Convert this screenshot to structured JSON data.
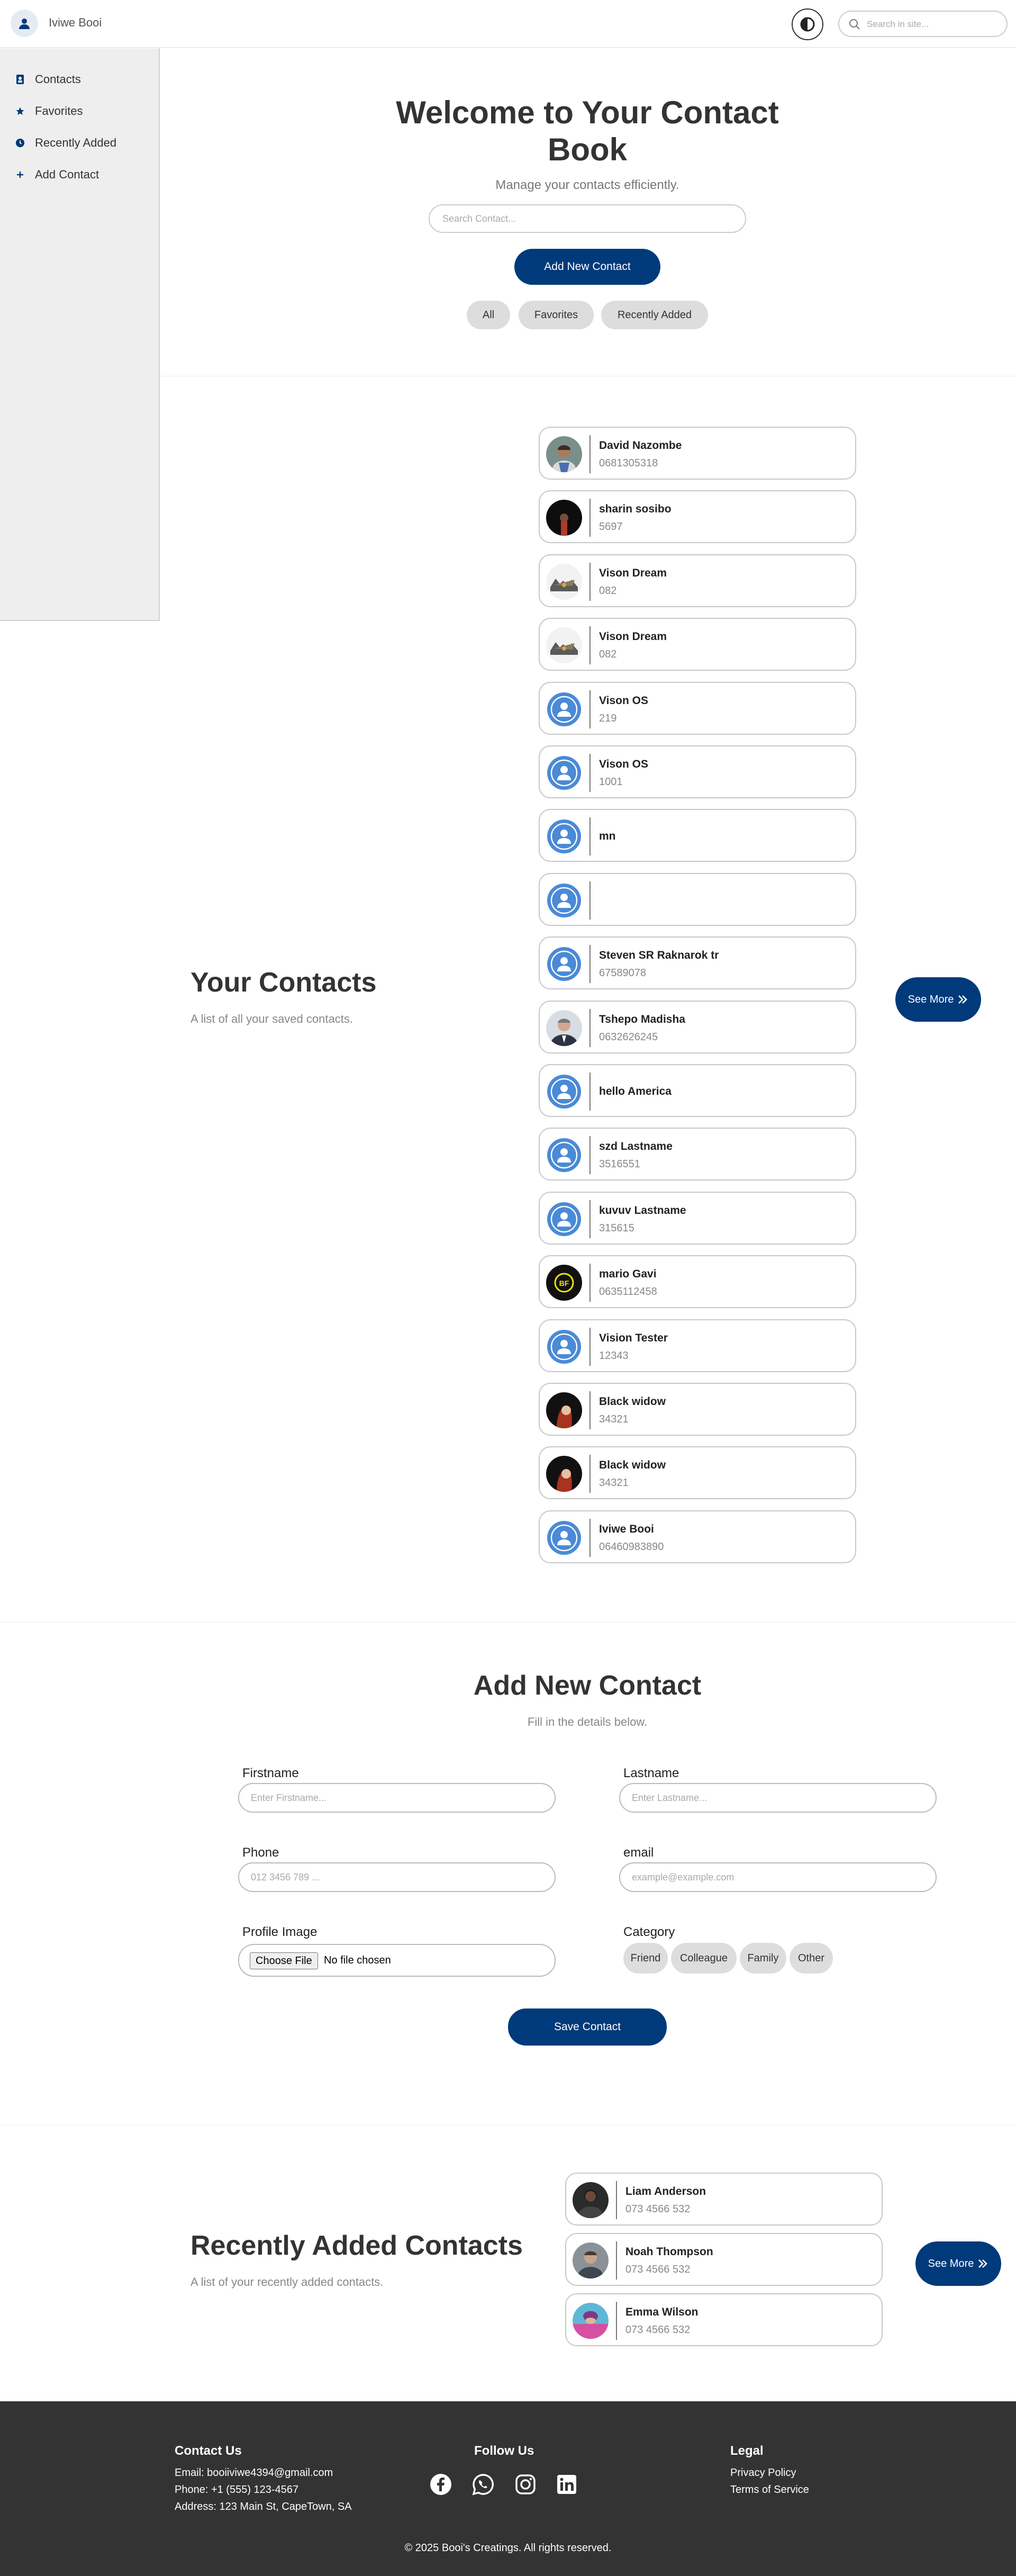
{
  "header": {
    "brand": "Iviwe Booi",
    "search_placeholder": "Search in site..."
  },
  "sidebar": {
    "items": [
      {
        "label": "Contacts",
        "icon": "address-book-icon"
      },
      {
        "label": "Favorites",
        "icon": "star-icon"
      },
      {
        "label": "Recently Added",
        "icon": "clock-icon"
      },
      {
        "label": "Add Contact",
        "icon": "plus-icon"
      }
    ]
  },
  "hero": {
    "title_line1": "Welcome to Your Contact",
    "title_line2": "Book",
    "subtitle": "Manage your contacts efficiently.",
    "search_placeholder": "Search Contact...",
    "add_button": "Add New Contact",
    "filters": [
      "All",
      "Favorites",
      "Recently Added"
    ]
  },
  "contacts_section": {
    "title": "Your Contacts",
    "subtitle": "A list of all your saved contacts.",
    "see_more": "See More",
    "contacts": [
      {
        "name": "David Nazombe",
        "phone": "0681305318",
        "avatar": "photo"
      },
      {
        "name": "sharin sosibo",
        "phone": "5697",
        "avatar": "photo"
      },
      {
        "name": "Vison Dream",
        "phone": "082",
        "avatar": "photo"
      },
      {
        "name": "Vison Dream",
        "phone": "082",
        "avatar": "photo"
      },
      {
        "name": "Vison OS",
        "phone": "219",
        "avatar": "default"
      },
      {
        "name": "Vison OS",
        "phone": "1001",
        "avatar": "default"
      },
      {
        "name": "mn",
        "phone": "",
        "avatar": "default"
      },
      {
        "name": "",
        "phone": "",
        "avatar": "default"
      },
      {
        "name": "Steven SR Raknarok tr",
        "phone": "67589078",
        "avatar": "default"
      },
      {
        "name": "Tshepo Madisha",
        "phone": "0632626245",
        "avatar": "photo"
      },
      {
        "name": "hello America",
        "phone": "",
        "avatar": "default"
      },
      {
        "name": "szd Lastname",
        "phone": "3516551",
        "avatar": "default"
      },
      {
        "name": "kuvuv Lastname",
        "phone": "315615",
        "avatar": "default"
      },
      {
        "name": "mario Gavi",
        "phone": "0635112458",
        "avatar": "logo"
      },
      {
        "name": "Vision Tester",
        "phone": "12343",
        "avatar": "default"
      },
      {
        "name": "Black widow",
        "phone": "34321",
        "avatar": "photo"
      },
      {
        "name": "Black widow",
        "phone": "34321",
        "avatar": "photo"
      },
      {
        "name": "Iviwe Booi",
        "phone": "06460983890",
        "avatar": "default"
      }
    ]
  },
  "form": {
    "title": "Add New Contact",
    "subtitle": "Fill in the details below.",
    "firstname_label": "Firstname",
    "firstname_placeholder": "Enter Firstname...",
    "lastname_label": "Lastname",
    "lastname_placeholder": "Enter Lastname...",
    "phone_label": "Phone",
    "phone_placeholder": "012 3456 789 ...",
    "email_label": "email",
    "email_placeholder": "example@example.com",
    "image_label": "Profile Image",
    "file_button": "Choose File",
    "file_status": "No file chosen",
    "category_label": "Category",
    "categories": [
      "Friend",
      "Colleague",
      "Family",
      "Other"
    ],
    "save_button": "Save Contact"
  },
  "recent": {
    "title": "Recently Added Contacts",
    "subtitle": "A list of your recently added contacts.",
    "see_more": "See More",
    "contacts": [
      {
        "name": "Liam Anderson",
        "phone": "073 4566 532"
      },
      {
        "name": "Noah Thompson",
        "phone": "073 4566 532"
      },
      {
        "name": "Emma Wilson",
        "phone": "073 4566 532"
      }
    ]
  },
  "footer": {
    "contact_heading": "Contact Us",
    "email": "Email: booiiviwe4394@gmail.com",
    "phone": "Phone: +1 (555) 123-4567",
    "address": "Address: 123 Main St, CapeTown, SA",
    "follow_heading": "Follow Us",
    "social_icons": [
      "facebook-icon",
      "whatsapp-icon",
      "instagram-icon",
      "linkedin-icon"
    ],
    "legal_heading": "Legal",
    "privacy": "Privacy Policy",
    "terms": "Terms of Service",
    "copyright": "© 2025 Booi's Creatings. All rights reserved."
  },
  "colors": {
    "primary": "#003a7a",
    "pill": "#dddddd",
    "footer_bg": "#333333",
    "default_avatar": "#4a8ad6"
  }
}
